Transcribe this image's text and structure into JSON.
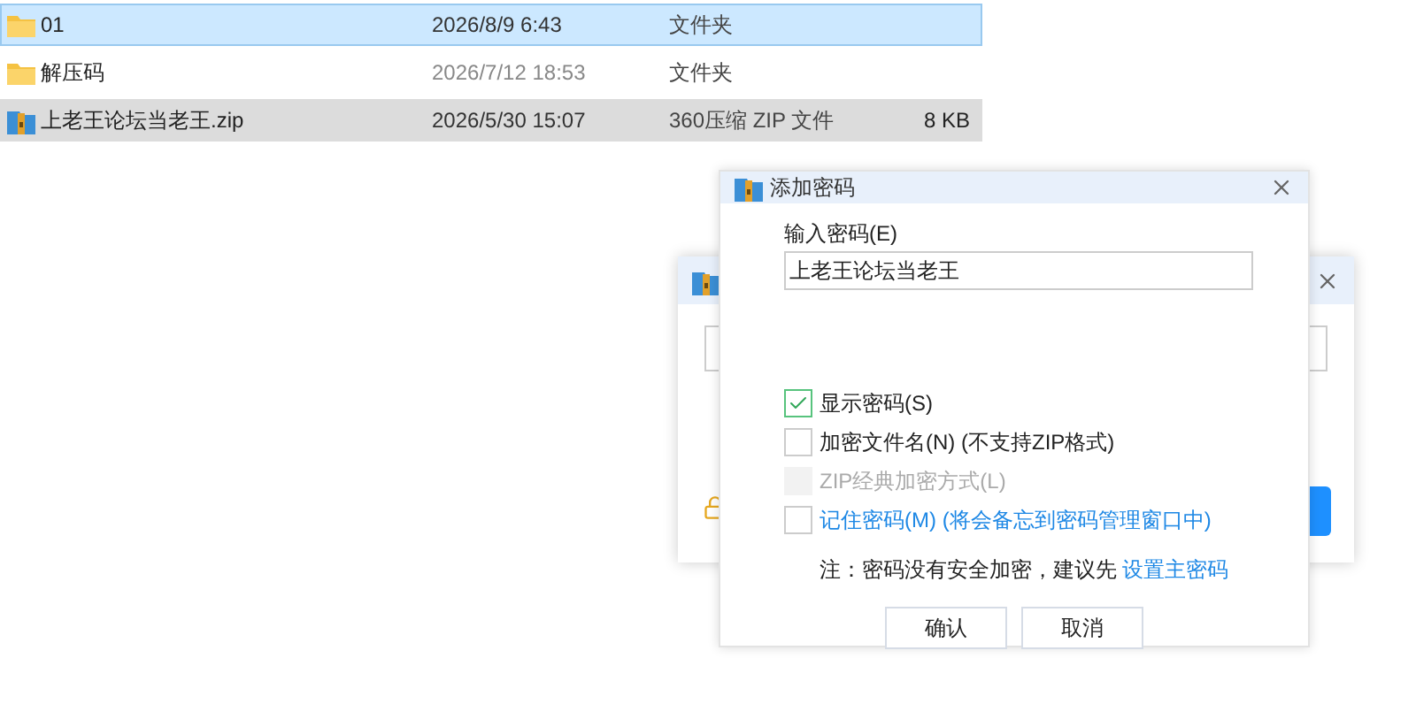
{
  "files": [
    {
      "name": "01",
      "date": "2026/8/9 6:43",
      "type": "文件夹",
      "kind": "folder",
      "selected": true
    },
    {
      "name": "解压码",
      "date": "2026/7/12 18:53",
      "type": "文件夹",
      "kind": "folder",
      "selected": false
    },
    {
      "name": "上老王论坛当老王.zip",
      "date": "2026/5/30 15:07",
      "type": "360压缩 ZIP 文件",
      "size": "8 KB",
      "kind": "zip",
      "selected": false,
      "hovered": true
    }
  ],
  "dialog": {
    "title": "添加密码",
    "field_label": "输入密码(E)",
    "password": "上老王论坛当老王",
    "options": [
      {
        "label": "显示密码(S)",
        "checked": true,
        "disabled": false,
        "kind": "plain"
      },
      {
        "label": "加密文件名(N) (不支持ZIP格式)",
        "checked": false,
        "disabled": false,
        "kind": "plain"
      },
      {
        "label": "ZIP经典加密方式(L)",
        "checked": false,
        "disabled": true,
        "kind": "plain"
      },
      {
        "label": "记住密码(M) (将会备忘到密码管理窗口中)",
        "checked": false,
        "disabled": false,
        "kind": "link"
      }
    ],
    "note": {
      "text": "注：密码没有安全加密，建议先",
      "link": "设置主密码"
    },
    "buttons": [
      "确认",
      "取消"
    ]
  }
}
